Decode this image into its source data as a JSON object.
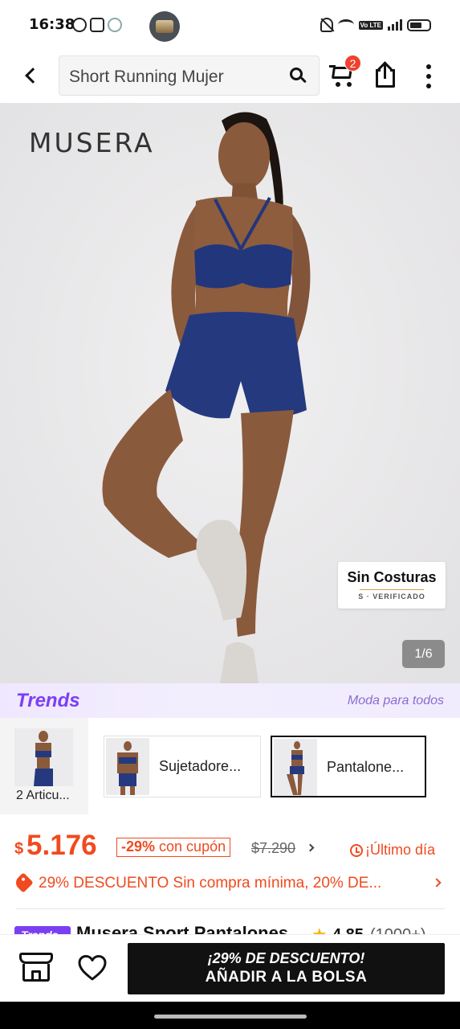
{
  "status_bar": {
    "time": "16:38",
    "left_icons": [
      "whatsapp-icon",
      "instagram-icon",
      "tiktok-icon"
    ],
    "right_icons": [
      "mute-icon",
      "wifi-icon",
      "volte-icon",
      "signal-icon",
      "battery-icon"
    ],
    "volte": "Vo LTE"
  },
  "header": {
    "search_value": "Short Running Mujer",
    "cart_count": "2"
  },
  "product_image": {
    "brand": "MUSERA",
    "badge_title": "Sin Costuras",
    "badge_subtitle": "S · VERIFICADO",
    "page_counter": "1/6"
  },
  "trends": {
    "logo": "Trends",
    "tagline": "Moda para todos"
  },
  "variants": {
    "all_label": "2 Articu...",
    "items": [
      {
        "label": "Sujetadore...",
        "selected": false
      },
      {
        "label": "Pantalone...",
        "selected": true
      }
    ]
  },
  "price": {
    "currency": "$",
    "value": "5.176",
    "discount_percent": "-29%",
    "discount_suffix": " con cupón",
    "original": "$7.290",
    "last_day": "¡Último día"
  },
  "coupon": {
    "text": "29% DESCUENTO Sin compra mínima,  20% DE..."
  },
  "product": {
    "tag": "Trends",
    "title": "Musera Sport Pantalones",
    "rating": "4.85",
    "rating_count": "(1000+)"
  },
  "bottom_bar": {
    "promo": "¡29% DE DESCUENTO!",
    "add_label": "AÑADIR A LA BOLSA"
  },
  "colors": {
    "accent": "#f04a1f",
    "trends_purple": "#7b3ff2",
    "cart_badge": "#f0412f",
    "star": "#f6b400"
  }
}
